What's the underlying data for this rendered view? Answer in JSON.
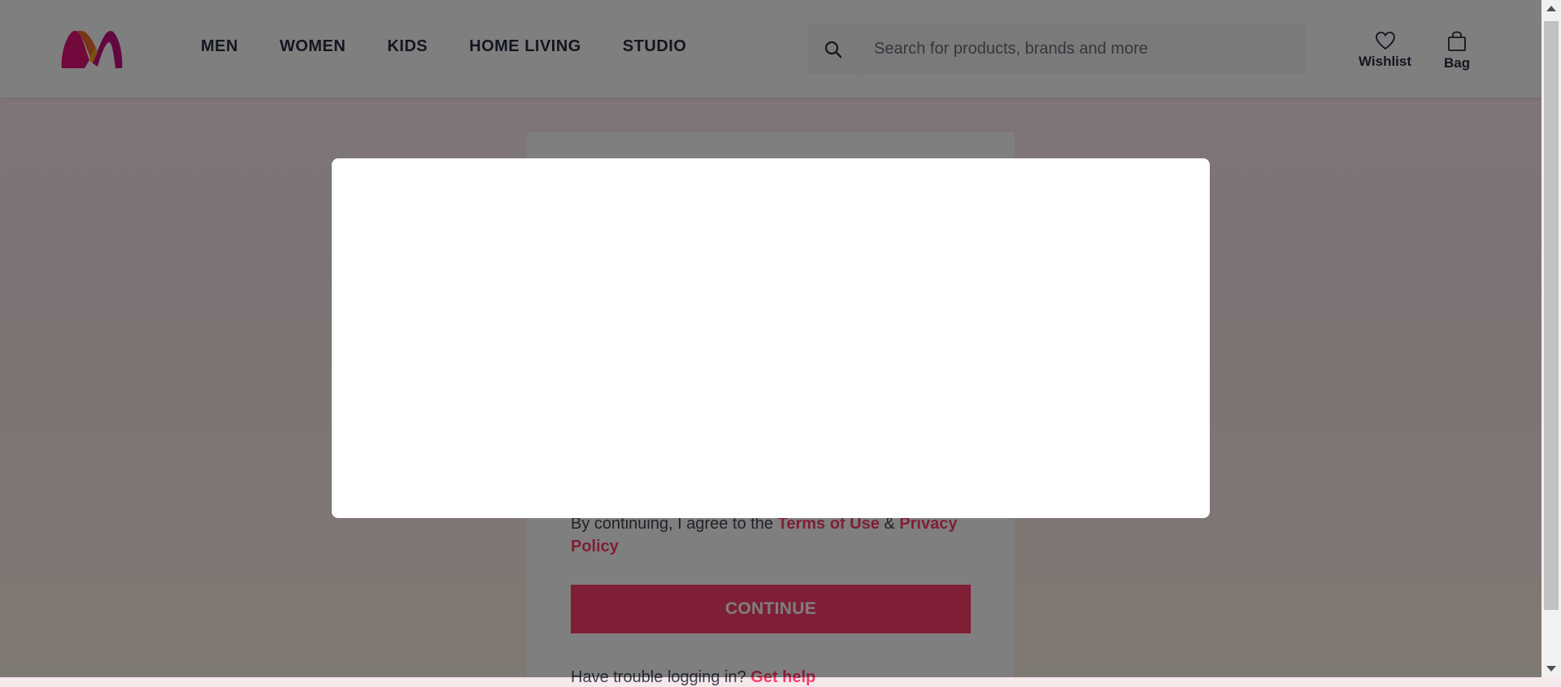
{
  "header": {
    "nav": [
      {
        "label": "MEN"
      },
      {
        "label": "WOMEN"
      },
      {
        "label": "KIDS"
      },
      {
        "label": "HOME LIVING"
      },
      {
        "label": "STUDIO"
      }
    ],
    "search": {
      "placeholder": "Search for products, brands and more",
      "icon": "search-icon"
    },
    "wishlist_label": "Wishlist",
    "bag_label": "Bag"
  },
  "login": {
    "agree_prefix": "By continuing, I agree to the ",
    "terms_label": "Terms of Use",
    "amp": " & ",
    "privacy_label": "Privacy Policy",
    "continue_label": "CONTINUE",
    "trouble_prefix": "Have trouble logging in? ",
    "trouble_link": "Get help"
  },
  "colors": {
    "brand_pink": "#ff3f6c",
    "overlay": "rgba(0,0,0,0.5)",
    "text_dark": "#282c3f"
  }
}
